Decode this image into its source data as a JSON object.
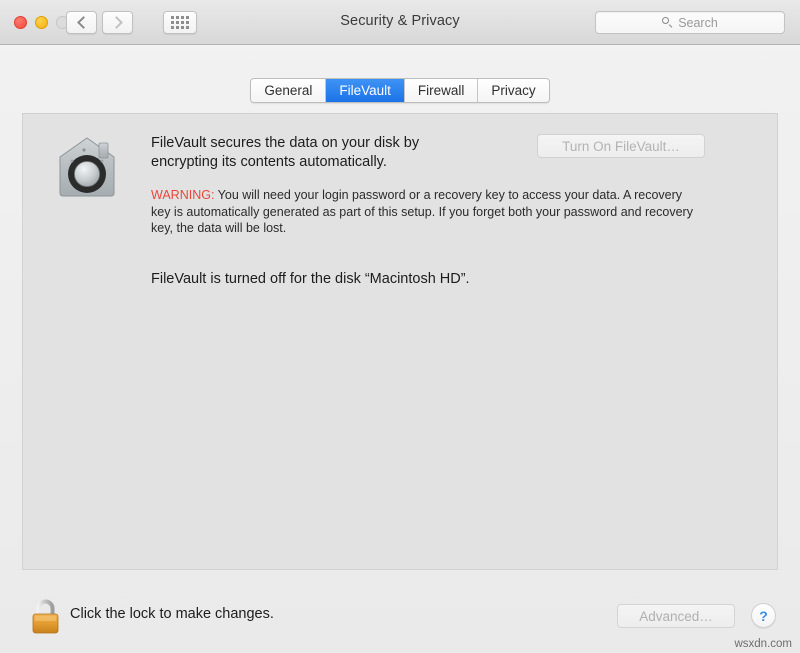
{
  "window": {
    "title": "Security & Privacy",
    "traffic_lights": [
      {
        "name": "close",
        "color": "#f04a3f"
      },
      {
        "name": "minimize",
        "color": "#f5b10c"
      },
      {
        "name": "zoom",
        "color": "#dcdcdc"
      }
    ],
    "nav": {
      "back_icon": "chevron-left-icon",
      "forward_icon": "chevron-right-icon",
      "show_all_icon": "grid-icon"
    },
    "search": {
      "icon": "search-icon",
      "placeholder": "Search",
      "value": ""
    }
  },
  "tabs": [
    {
      "label": "General",
      "active": false
    },
    {
      "label": "FileVault",
      "active": true
    },
    {
      "label": "Firewall",
      "active": false
    },
    {
      "label": "Privacy",
      "active": false
    }
  ],
  "main": {
    "icon": "filevault-house-icon",
    "description": "FileVault secures the data on your disk by encrypting its contents automatically.",
    "warning_label": "WARNING:",
    "warning_body": "You will need your login password or a recovery key to access your data. A recovery key is automatically generated as part of this setup. If you forget both your password and recovery key, the data will be lost.",
    "status": "FileVault is turned off for the disk “Macintosh HD”.",
    "turn_on_button": "Turn On FileVault…"
  },
  "footer": {
    "lock_icon": "closed-padlock-icon",
    "lock_text": "Click the lock to make changes.",
    "advanced_button": "Advanced…",
    "help_button": "?"
  },
  "watermark": "wsxdn.com",
  "colors": {
    "accent": "#1b73e8",
    "warning": "#e8493a",
    "help": "#3d8ee0",
    "lock_body": "#e8a33d"
  }
}
